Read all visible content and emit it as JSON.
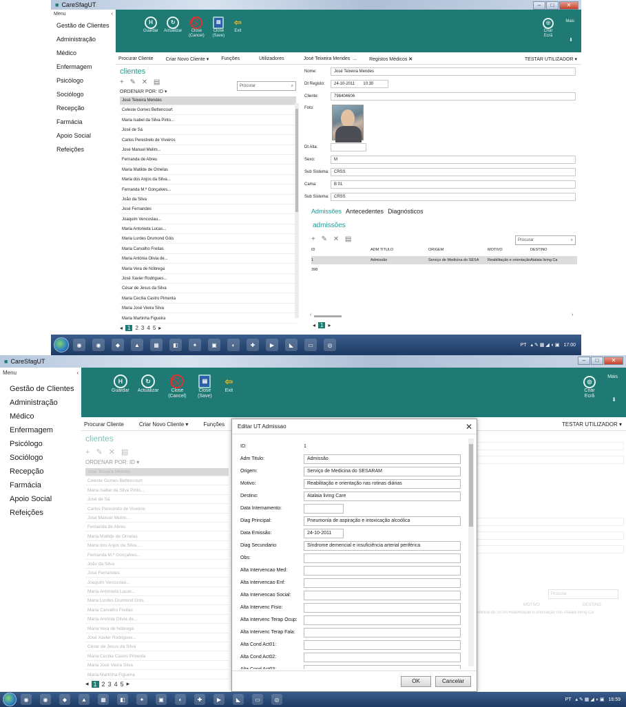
{
  "window": {
    "title": "CareSfagUT"
  },
  "menu": {
    "header": "Menu",
    "collapse_glyph": "‹",
    "items": [
      "Gestão de Clientes",
      "Administração",
      "Médico",
      "Enfermagem",
      "Psicólogo",
      "Sociólogo",
      "Recepção",
      "Farmácia",
      "Apoio Social",
      "Refeições"
    ]
  },
  "ribbon": {
    "guardar": "Guardar",
    "actualizar": "Actualizar",
    "close_cancel": "Close (Cancel)",
    "close_save": "Close (Save)",
    "exit": "Exit",
    "mais": "Mais",
    "criar_ecra": "Criar Ecrã"
  },
  "tabs": {
    "procurar": "Procurar Cliente",
    "criar": "Criar Novo Cliente ▾",
    "funcoes": "Funções",
    "utilizadores": "Utilizadores",
    "jose": "José Teixeira Mendes",
    "ellipsis": "...",
    "registos": "Registos Médicos",
    "close_glyph": "✕",
    "testar": "TESTAR UTILIZADOR ▾"
  },
  "clients": {
    "title": "clientes",
    "tools": "+ ✎ ✕ ▤",
    "search_placeholder": "Procurar",
    "order_by": "ORDENAR POR: ID ▾",
    "rows": [
      "José Teixeira Mendes",
      "Celeste Gomes Bettencourt",
      "Maria Isabel da Silva Pinto...",
      "José de Sá",
      "Carlos Perestrelo de Viveiros",
      "José Manuel Melim...",
      "Fernanda de Abreu",
      "Maria Matilde de Ornelas",
      "Maria dos Anjos da Silva...",
      "Fernanda M.ª Gonçalves...",
      "João da Silva",
      "José Fernandes",
      "Joaquim Vencoslau...",
      "Maria Antonieta Lucas...",
      "Maria Lurdes Drumond Góis",
      "Maria Carvalho Freitas",
      "Maria Antónia Olivia de...",
      "Maria Vera de Nóbrega",
      "José Xavier Rodrigues...",
      "César de Jesus da Silva",
      "Maria Cecília Castro Pimenta",
      "Maria José Vieira Silva",
      "Maria Martinha Figueira"
    ],
    "pages": [
      "1",
      "2",
      "3",
      "4",
      "5"
    ],
    "prev": "◂",
    "next": "▸"
  },
  "detail": {
    "nome_label": "Nome:",
    "nome": "José Teixeira Mendes",
    "dt_registo_label": "Dt Registo:",
    "dt_registo": "24-10-2011",
    "hora": "10:30",
    "cliente_label": "Cliente:",
    "cliente": "798404606",
    "foto_label": "Foto:",
    "dt_alta_label": "Dt Alta:",
    "dt_alta": "",
    "sexo_label": "Sexo:",
    "sexo": "M",
    "sub_sistema_label": "Sub Sistema:",
    "sub_sistema": "CRSS",
    "cama_label": "Cama:",
    "cama": "B 01",
    "sub_sistema2_label": "Sub Sistema:",
    "sub_sistema2": "CRSS"
  },
  "subtabs": [
    "Admissões",
    "Antecedentes",
    "Diagnósticos"
  ],
  "admissoes": {
    "title": "admissões",
    "tools": "+ ✎ ✕ ▤",
    "search_placeholder": "Procurar",
    "columns": [
      "ID",
      "ADM TITULO",
      "ORIGEM",
      "MOTIVO",
      "DESTINO"
    ],
    "rows": [
      [
        "1",
        "Admissão",
        "Serviço de Medicina do SESA",
        "Reabilitação e orientação nas",
        "Atalaia living Ca"
      ],
      [
        "398",
        "",
        "",
        "",
        ""
      ]
    ],
    "page": "1"
  },
  "taskbar": {
    "lang": "PT",
    "time1": "17:00",
    "time2": "16:59"
  },
  "dialog": {
    "title": "Editar UT Admissao",
    "close_glyph": "✕",
    "fields": [
      {
        "label": "ID:",
        "value": "1"
      },
      {
        "label": "Adm Titulo:",
        "value": "Admissão"
      },
      {
        "label": "Origem:",
        "value": "Serviço de Medicina do SESARAM"
      },
      {
        "label": "Motivo:",
        "value": "Reabilitação e orientação nas rotinas diárias"
      },
      {
        "label": "Destino:",
        "value": "Atalaia living Care"
      },
      {
        "label": "Data Internamento:",
        "value": ""
      },
      {
        "label": "Diag Principal:",
        "value": "Pneumonia de aspiração e intoxicação alcoólica"
      },
      {
        "label": "Data Emissão:",
        "value": "24-10-2011"
      },
      {
        "label": "Diag Secundario:",
        "value": "Síndrome demencial e insuficiência arterial periférica"
      },
      {
        "label": "Obs:",
        "value": ""
      },
      {
        "label": "Alta Intervencao Med:",
        "value": ""
      },
      {
        "label": "Alta Intervencao Enf:",
        "value": ""
      },
      {
        "label": "Alta Intervencao Social:",
        "value": ""
      },
      {
        "label": "Alta Intervenc Fisio:",
        "value": ""
      },
      {
        "label": "Alta Intervenc Terap Ocup:",
        "value": ""
      },
      {
        "label": "Alta Intervenc Terap Fala:",
        "value": ""
      },
      {
        "label": "Alta Cond Act01:",
        "value": ""
      },
      {
        "label": "Alta Cond Act02:",
        "value": ""
      },
      {
        "label": "Alta Cond Act03:",
        "value": ""
      }
    ],
    "ok": "OK",
    "cancel": "Cancelar"
  },
  "bg_grid_fragments": {
    "motivo": "MOTIVO",
    "destino": "DESTINO",
    "row_text": "edicina do SESA Reabilitação e orientação nas Atalaia living Ca"
  }
}
